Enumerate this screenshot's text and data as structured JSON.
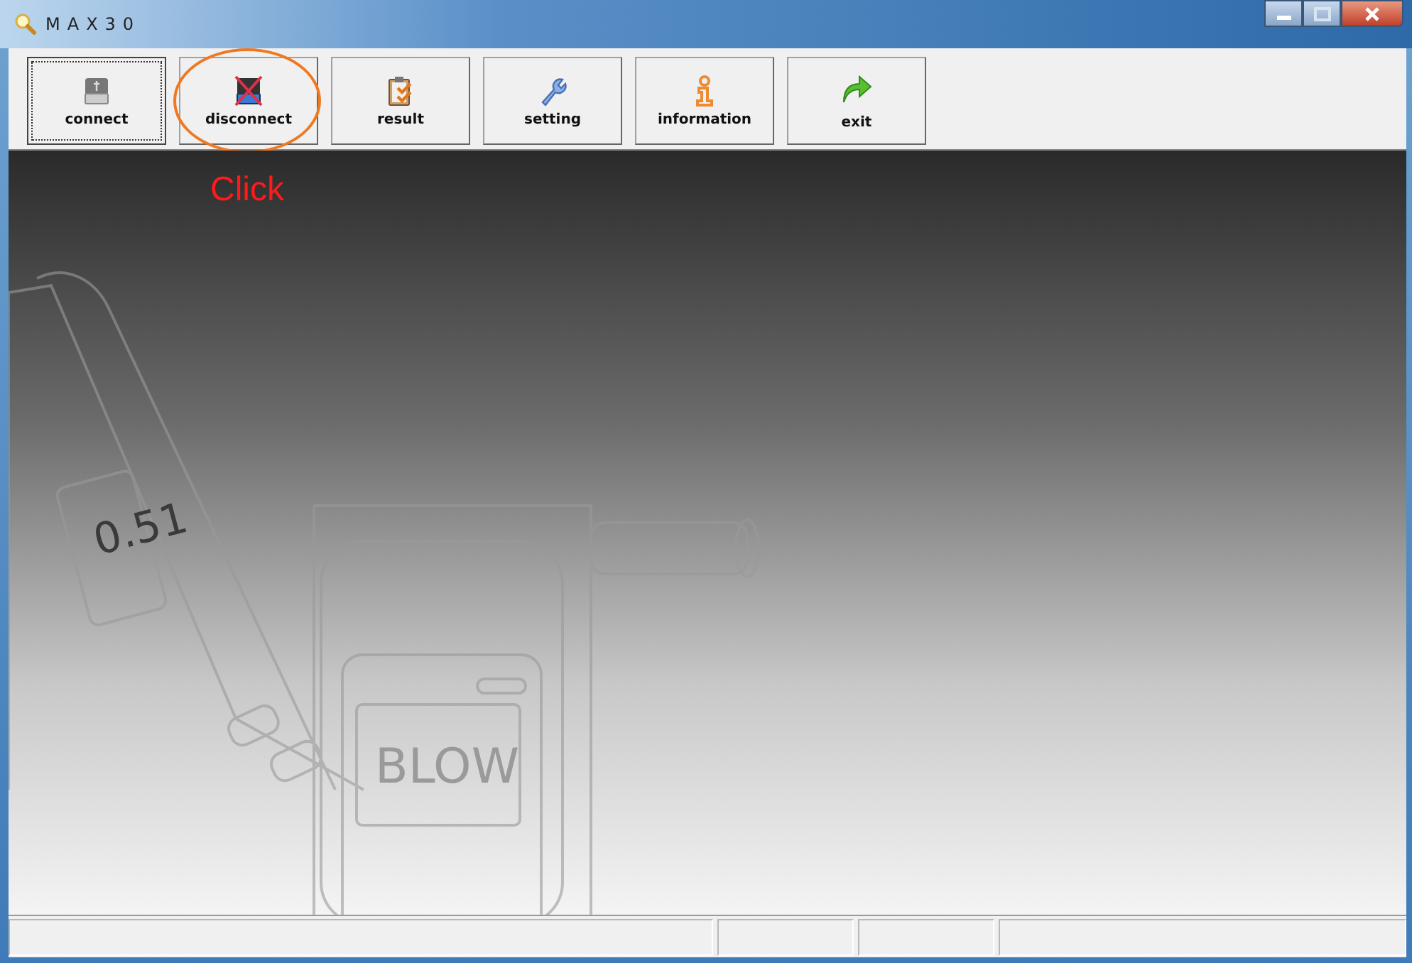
{
  "window": {
    "title": "MAX30"
  },
  "toolbar": [
    {
      "kind": "connect",
      "label": "connect",
      "focused": true,
      "annotated": false
    },
    {
      "kind": "disconnect",
      "label": "disconnect",
      "focused": false,
      "annotated": true
    },
    {
      "kind": "result",
      "label": "result",
      "focused": false,
      "annotated": false
    },
    {
      "kind": "setting",
      "label": "setting",
      "focused": false,
      "annotated": false
    },
    {
      "kind": "information",
      "label": "information",
      "focused": false,
      "annotated": false
    },
    {
      "kind": "exit",
      "label": "exit",
      "focused": false,
      "annotated": false
    }
  ],
  "annotation": {
    "text": "Click"
  },
  "illustration": {
    "display_reading": "0.51",
    "display_message": "BLOW"
  }
}
